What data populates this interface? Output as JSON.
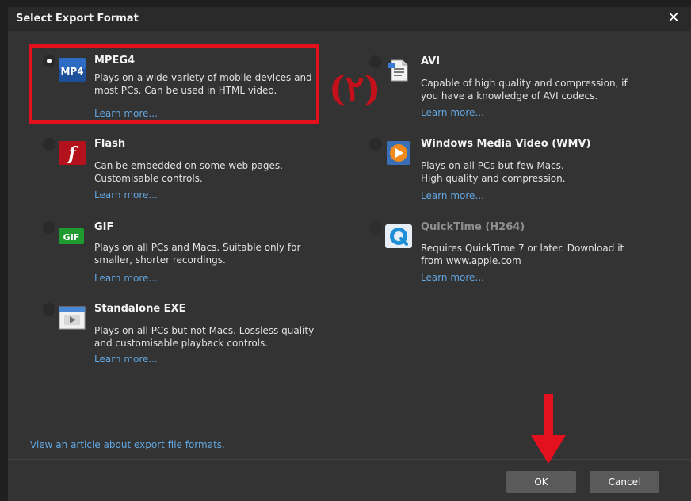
{
  "dialog": {
    "title": "Select Export Format",
    "close_label": "✕"
  },
  "options": [
    {
      "id": "mpeg4",
      "title": "MPEG4",
      "desc_lines": [
        "Plays on a wide variety of mobile devices and",
        "most PCs. Can be used in HTML video."
      ],
      "link": "Learn more...",
      "icon": "mp4-icon",
      "icon_text": "MP4",
      "selected": true,
      "disabled": false
    },
    {
      "id": "avi",
      "title": "AVI",
      "desc_lines": [
        "Capable of high quality and compression, if",
        "you have a knowledge of AVI codecs."
      ],
      "link": "Learn more...",
      "icon": "avi-file-icon",
      "selected": false,
      "disabled": false
    },
    {
      "id": "flash",
      "title": "Flash",
      "desc_lines": [
        "Can be embedded on some web pages.",
        "Customisable controls."
      ],
      "link": "Learn more...",
      "icon": "flash-icon",
      "icon_text": "f",
      "selected": false,
      "disabled": false
    },
    {
      "id": "wmv",
      "title": "Windows Media Video (WMV)",
      "desc_lines": [
        "Plays on all PCs but few Macs.",
        "High quality and compression."
      ],
      "link": "Learn more...",
      "icon": "windows-media-icon",
      "selected": false,
      "disabled": false
    },
    {
      "id": "gif",
      "title": "GIF",
      "desc_lines": [
        "Plays on all PCs and Macs. Suitable only for",
        "smaller, shorter recordings."
      ],
      "link": "Learn more...",
      "icon": "gif-icon",
      "icon_text": "GIF",
      "selected": false,
      "disabled": false
    },
    {
      "id": "quicktime",
      "title": "QuickTime (H264)",
      "desc_lines": [
        "Requires QuickTime 7 or later. Download it",
        "from www.apple.com"
      ],
      "link": "Learn more...",
      "icon": "quicktime-icon",
      "selected": false,
      "disabled": true
    },
    {
      "id": "exe",
      "title": "Standalone EXE",
      "desc_lines": [
        "Plays on all PCs but not Macs. Lossless quality",
        "and customisable playback controls."
      ],
      "link": "Learn more...",
      "icon": "standalone-exe-icon",
      "selected": false,
      "disabled": false
    }
  ],
  "annotation": {
    "step_label": "(٢)",
    "color": "#e3101e"
  },
  "footer": {
    "article_link": "View an article about export file formats.",
    "ok_label": "OK",
    "cancel_label": "Cancel"
  },
  "colors": {
    "background": "#333333",
    "link": "#62a6e0",
    "button": "#5a5a5a"
  }
}
